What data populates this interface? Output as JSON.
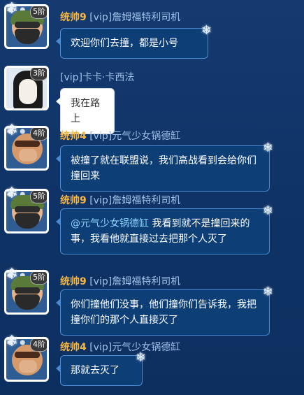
{
  "messages": [
    {
      "rank": "5阶",
      "level_tag": "统帅9",
      "name": "[vip]詹姆福特利司机",
      "text": "欢迎你们去撞，都是小号",
      "avatar": "green-hat-glasses-avatar"
    },
    {
      "rank": "3阶",
      "level_tag": "",
      "name": "[vip]卡卡·卡西法",
      "text": "我在路上",
      "avatar": "black-hair-girl-avatar"
    },
    {
      "rank": "4阶",
      "level_tag": "统帅4",
      "name": "[vip]元气少女锅德缸",
      "text": "被撞了就在联盟说，我们高战看到会给你们撞回来",
      "avatar": "hand-over-mouth-avatar"
    },
    {
      "rank": "5阶",
      "level_tag": "统帅9",
      "name": "[vip]詹姆福特利司机",
      "mention": "@元气少女锅德缸",
      "text": " 我看到就不是撞回来的事，我看他就直接过去把那个人灭了",
      "avatar": "green-hat-glasses-avatar"
    },
    {
      "rank": "5阶",
      "level_tag": "统帅9",
      "name": "[vip]詹姆福特利司机",
      "text": "你们撞他们没事，他们撞你们告诉我，我把撞你们的那个人直接灭了",
      "avatar": "green-hat-glasses-avatar"
    },
    {
      "rank": "4阶",
      "level_tag": "统帅4",
      "name": "[vip]元气少女锅德缸",
      "text": "那就去灭了",
      "avatar": "hand-over-mouth-avatar"
    }
  ],
  "colors": {
    "background": "#113768",
    "bubble": "#0e3e76",
    "bubble_border": "#4b8ad0",
    "level_tag": "#f4b642",
    "name": "#9fc0e8",
    "mention": "#8fd3ff"
  }
}
